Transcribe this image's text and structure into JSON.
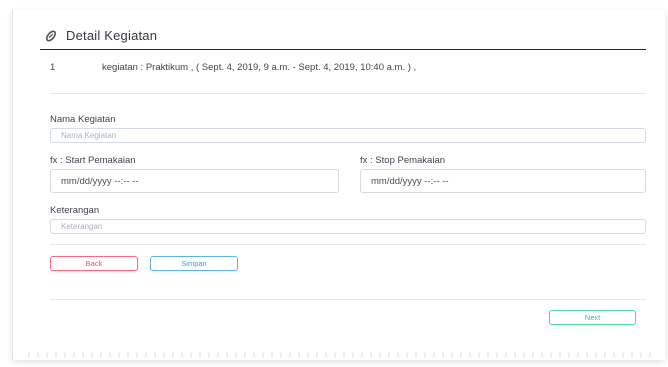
{
  "header": {
    "title": "Detail Kegiatan",
    "icon": "paperclip-icon"
  },
  "info_row": {
    "number": "1",
    "text": "kegiatan : Praktikum , ( Sept. 4, 2019, 9 a.m. - Sept. 4, 2019, 10:40 a.m. ) ,"
  },
  "form": {
    "nama_label": "Nama Kegiatan",
    "nama_placeholder": "Nama Kegiatan",
    "start_label": "fx : Start Pemakaian",
    "start_value": "mm/dd/yyyy --:-- --",
    "stop_label": "fx : Stop Pemakaian",
    "stop_value": "mm/dd/yyyy --:-- --",
    "keterangan_label": "Keterangan",
    "keterangan_placeholder": "Keterangan"
  },
  "buttons": {
    "back": "Back",
    "save": "Simpan",
    "next": "Next"
  },
  "colors": {
    "back": "#e8506b",
    "save": "#3a9be0",
    "next": "#2fbf93"
  }
}
